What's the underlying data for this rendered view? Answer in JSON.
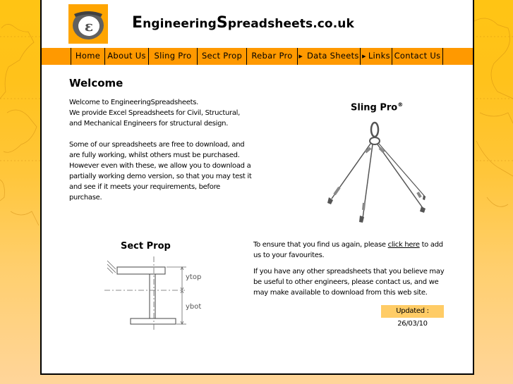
{
  "site": {
    "title_parts": [
      {
        "cap": "E",
        "rest": "ngineering"
      },
      {
        "cap": "S",
        "rest": "preadsheets.co.uk"
      }
    ],
    "logo_icon": "es-logo-icon"
  },
  "nav": {
    "items": [
      {
        "label": "Home",
        "has_arrow": false
      },
      {
        "label": "About Us",
        "has_arrow": false
      },
      {
        "label": "Sling Pro",
        "has_arrow": false
      },
      {
        "label": "Sect Prop",
        "has_arrow": false
      },
      {
        "label": "Rebar Pro",
        "has_arrow": false
      },
      {
        "label": "Data Sheets",
        "has_arrow": true
      },
      {
        "label": "Links",
        "has_arrow": true
      },
      {
        "label": "Contact Us",
        "has_arrow": false
      }
    ],
    "arrow_glyph": "▶"
  },
  "main": {
    "heading": "Welcome",
    "intro_paragraphs": [
      "Welcome to EngineeringSpreadsheets.\nWe provide Excel Spreadsheets for Civil, Structural, and Mechanical Engineers for structural design.",
      "Some of our spreadsheets are free to download, and are fully working, whilst others must be purchased. However even with these, we allow you to download a partially working demo version, so that you may test it and see if it meets your requirements, before purchase."
    ],
    "sling_pro": {
      "title": "Sling Pro",
      "reg": "®"
    },
    "sect_prop": {
      "title": "Sect Prop",
      "label_top": "ytop",
      "label_bot": "ybot"
    },
    "favourites": {
      "before": "To ensure that you find us again, please ",
      "link": "click here",
      "after": " to add us to your favourites."
    },
    "contact_text": "If you have any other spreadsheets that you believe may be useful to other engineers, please contact us, and we may make available to download from this web site.",
    "updated": "Updated : 26/03/10"
  },
  "colors": {
    "nav_bg": "#ff9900",
    "updated_bg": "#ffcc66",
    "page_bg": "#ffffff",
    "body_bg": "#ffc414"
  }
}
